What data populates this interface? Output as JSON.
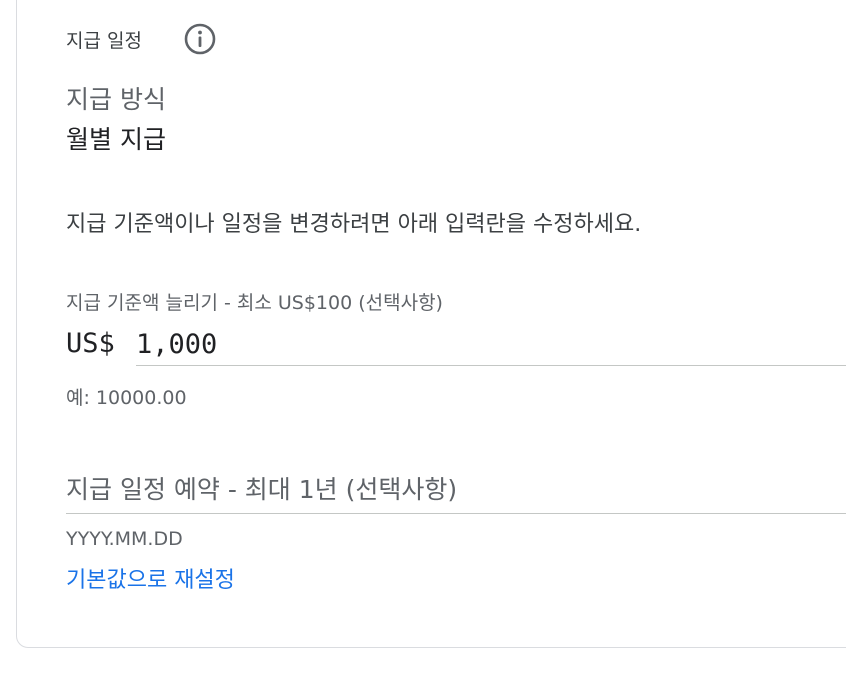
{
  "section": {
    "title": "지급 일정",
    "info_icon": "info-icon"
  },
  "method": {
    "label": "지급 방식",
    "value": "월별 지급"
  },
  "help_text": "지급 기준액이나 일정을 변경하려면 아래 입력란을 수정하세요.",
  "threshold": {
    "label": "지급 기준액 늘리기 - 최소 US$100 (선택사항)",
    "currency": "US$",
    "value": "1,000",
    "hint": "예: 10000.00"
  },
  "schedule": {
    "placeholder": "지급 일정 예약 - 최대 1년 (선택사항)",
    "value": "",
    "date_hint": "YYYY.MM.DD"
  },
  "reset_link": "기본값으로 재설정",
  "colors": {
    "link": "#1a73e8",
    "border": "#dadce0",
    "secondary_text": "#5f6368",
    "primary_text": "#202124"
  }
}
